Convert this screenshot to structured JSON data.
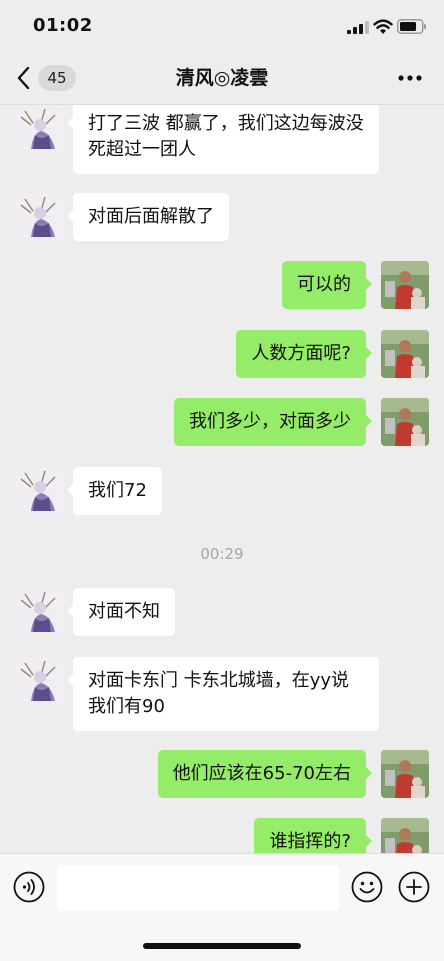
{
  "status_bar": {
    "time": "01:02"
  },
  "nav": {
    "unread_count": "45",
    "title": "清风◎凌雲"
  },
  "messages": [
    {
      "side": "left",
      "text": "打了三波  都赢了，我们这边每波没死超过一团人"
    },
    {
      "side": "left",
      "text": "对面后面解散了"
    },
    {
      "side": "right",
      "text": "可以的"
    },
    {
      "side": "right",
      "text": "人数方面呢?"
    },
    {
      "side": "right",
      "text": "我们多少，对面多少"
    },
    {
      "side": "left",
      "text": "我们72"
    },
    {
      "side": "time",
      "text": "00:29"
    },
    {
      "side": "left",
      "text": "对面不知"
    },
    {
      "side": "left",
      "text": "对面卡东门  卡东北城墙，在yy说我们有90"
    },
    {
      "side": "right",
      "text": "他们应该在65-70左右"
    },
    {
      "side": "right",
      "text": "谁指挥的?"
    }
  ],
  "input": {
    "placeholder": ""
  },
  "colors": {
    "background": "#ededed",
    "outgoing_bubble": "#95ec69",
    "incoming_bubble": "#ffffff",
    "timestamp_text": "#a6a6a6"
  },
  "icons": {
    "back": "chevron-left-icon",
    "more": "more-dots-icon",
    "voice": "voice-icon",
    "emoji": "emoji-icon",
    "plus": "plus-icon"
  }
}
